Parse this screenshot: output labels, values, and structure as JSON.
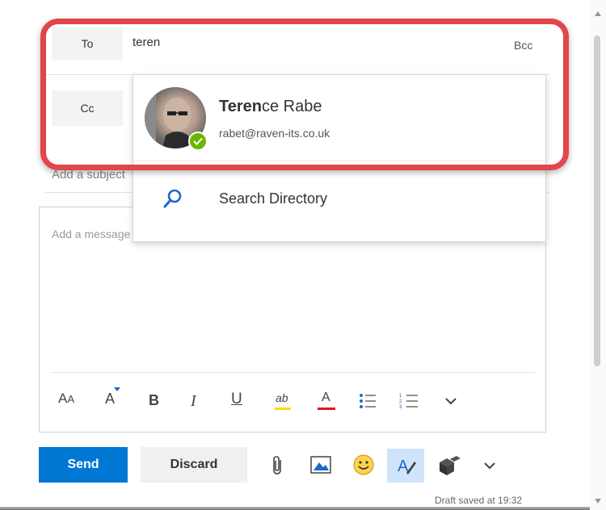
{
  "recipients": {
    "to_label": "To",
    "to_value": "teren",
    "bcc_label": "Bcc",
    "cc_label": "Cc"
  },
  "subject": {
    "placeholder": "Add a subject"
  },
  "message": {
    "placeholder": "Add a message or drag a file here"
  },
  "suggestion": {
    "name_match": "Teren",
    "name_rest": "ce Rabe",
    "email": "rabet@raven-its.co.uk",
    "presence": "available"
  },
  "search_directory": {
    "label": "Search Directory"
  },
  "format_toolbar": {
    "font_size_icon": "A",
    "font_size_sub": "A",
    "grow_icon": "A",
    "bold": "B",
    "italic": "I",
    "underline": "U",
    "highlight": "ab",
    "font_color": "A"
  },
  "actions": {
    "send": "Send",
    "discard": "Discard"
  },
  "status": {
    "draft_saved": "Draft saved at 19:32"
  },
  "colors": {
    "accent": "#0078d4",
    "highlight_outline": "#e2454b",
    "presence_green": "#6bb700",
    "font_color_red": "#e81123",
    "highlight_yellow": "#ffd800"
  }
}
